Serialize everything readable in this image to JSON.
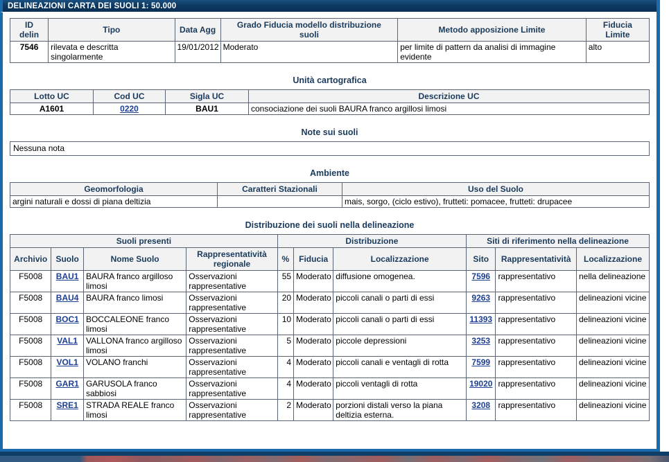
{
  "window": {
    "title": "DELINEAZIONI CARTA DEI SUOLI 1: 50.000"
  },
  "delineation": {
    "headers": [
      "ID delin",
      "Tipo",
      "Data Agg",
      "Grado Fiducia modello distribuzione suoli",
      "Metodo apposizione Limite",
      "Fiducia Limite"
    ],
    "header_id_line1": "ID",
    "header_id_line2": "delin",
    "header_grado_line1": "Grado Fiducia modello distribuzione",
    "header_grado_line2": "suoli",
    "header_tipo": "Tipo",
    "header_data_agg": "Data Agg",
    "header_metodo": "Metodo apposizione Limite",
    "header_fiducia_line1": "Fiducia",
    "header_fiducia_line2": "Limite",
    "row": {
      "id_delin": "7546",
      "tipo": "rilevata e descritta singolarmente",
      "data_agg": "19/01/2012",
      "grado_fiducia": "Moderato",
      "metodo_limite": "per limite di pattern da analisi di immagine evidente",
      "fiducia_limite": "alto"
    }
  },
  "unita_cartografica": {
    "title": "Unità cartografica",
    "headers": [
      "Lotto UC",
      "Cod UC",
      "Sigla UC",
      "Descrizione UC"
    ],
    "row": {
      "lotto_uc": "A1601",
      "cod_uc": "0220",
      "sigla_uc": "BAU1",
      "descrizione_uc": "consociazione dei suoli BAURA franco argillosi limosi"
    }
  },
  "note_suoli": {
    "title": "Note sui suoli",
    "text": "Nessuna nota"
  },
  "ambiente": {
    "title": "Ambiente",
    "headers": [
      "Geomorfologia",
      "Caratteri Stazionali",
      "Uso del Suolo"
    ],
    "row": {
      "geomorfologia": "argini naturali e dossi di piana deltizia",
      "caratteri_stazionali": "",
      "uso_del_suolo": "mais, sorgo, (ciclo estivo), frutteti: pomacee, frutteti: drupacee"
    }
  },
  "distribuzione": {
    "title": "Distribuzione dei suoli nella delineazione",
    "group_headers": {
      "suoli_presenti": "Suoli presenti",
      "distribuzione": "Distribuzione",
      "siti": "Siti di riferimento nella delineazione"
    },
    "col_headers": {
      "archivio": "Archivio",
      "suolo": "Suolo",
      "nome_suolo": "Nome Suolo",
      "rapp_reg_line1": "Rappresentatività",
      "rapp_reg_line2": "regionale",
      "perc": "%",
      "fiducia": "Fiducia",
      "localizzazione": "Localizzazione",
      "sito": "Sito",
      "rappresentativita": "Rappresentatività",
      "localizzazione2": "Localizzazione"
    },
    "rows": [
      {
        "archivio": "F5008",
        "suolo": "BAU1",
        "nome_suolo": "BAURA franco argilloso limosi",
        "rapp_regionale": "Osservazioni rappresentative",
        "perc": "55",
        "fiducia": "Moderato",
        "localizzazione": "diffusione omogenea.",
        "sito": "7596",
        "rappresentativita": "rappresentativo",
        "localizzazione_sito": "nella delineazione"
      },
      {
        "archivio": "F5008",
        "suolo": "BAU4",
        "nome_suolo": "BAURA franco limosi",
        "rapp_regionale": "Osservazioni rappresentative",
        "perc": "20",
        "fiducia": "Moderato",
        "localizzazione": "piccoli canali o parti di essi",
        "sito": "9263",
        "rappresentativita": "rappresentativo",
        "localizzazione_sito": "delineazioni vicine"
      },
      {
        "archivio": "F5008",
        "suolo": "BOC1",
        "nome_suolo": "BOCCALEONE franco limosi",
        "rapp_regionale": "Osservazioni rappresentative",
        "perc": "10",
        "fiducia": "Moderato",
        "localizzazione": "piccoli canali o parti di essi",
        "sito": "11393",
        "rappresentativita": "rappresentativo",
        "localizzazione_sito": "delineazioni vicine"
      },
      {
        "archivio": "F5008",
        "suolo": "VAL1",
        "nome_suolo": "VALLONA franco argilloso limosi",
        "rapp_regionale": "Osservazioni rappresentative",
        "perc": "5",
        "fiducia": "Moderato",
        "localizzazione": "piccole depressioni",
        "sito": "3253",
        "rappresentativita": "rappresentativo",
        "localizzazione_sito": "delineazioni vicine"
      },
      {
        "archivio": "F5008",
        "suolo": "VOL1",
        "nome_suolo": "VOLANO franchi",
        "rapp_regionale": "Osservazioni rappresentative",
        "perc": "4",
        "fiducia": "Moderato",
        "localizzazione": "piccoli canali e ventagli di rotta",
        "sito": "7599",
        "rappresentativita": "rappresentativo",
        "localizzazione_sito": "delineazioni vicine"
      },
      {
        "archivio": "F5008",
        "suolo": "GAR1",
        "nome_suolo": "GARUSOLA franco sabbiosi",
        "rapp_regionale": "Osservazioni rappresentative",
        "perc": "4",
        "fiducia": "Moderato",
        "localizzazione": "piccoli ventagli di rotta",
        "sito": "19020",
        "rappresentativita": "rappresentativo",
        "localizzazione_sito": "delineazioni vicine"
      },
      {
        "archivio": "F5008",
        "suolo": "SRE1",
        "nome_suolo": "STRADA REALE franco limosi",
        "rapp_regionale": "Osservazioni rappresentative",
        "perc": "2",
        "fiducia": "Moderato",
        "localizzazione": "porzioni distali verso la piana deltizia esterna.",
        "sito": "3208",
        "rappresentativita": "rappresentativo",
        "localizzazione_sito": "delineazioni vicine"
      }
    ]
  },
  "colors": {
    "titlebar_start": "#1b4f7e",
    "titlebar_end": "#0a2f54",
    "window_border": "#1a6bab",
    "header_text": "#1a3a5c",
    "header_bg": "#f2f2f2",
    "link": "#1c3f94",
    "grid_border": "#5a6470"
  }
}
